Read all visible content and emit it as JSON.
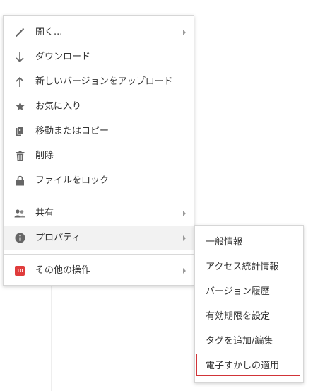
{
  "main_menu": {
    "items": [
      {
        "label": "開く...",
        "icon": "pencil-icon",
        "has_submenu": true
      },
      {
        "label": "ダウンロード",
        "icon": "arrow-down-icon",
        "has_submenu": false
      },
      {
        "label": "新しいバージョンをアップロード",
        "icon": "arrow-up-icon",
        "has_submenu": false
      },
      {
        "label": "お気に入り",
        "icon": "star-icon",
        "has_submenu": false
      },
      {
        "label": "移動またはコピー",
        "icon": "copy-icon",
        "has_submenu": false
      },
      {
        "label": "削除",
        "icon": "trash-icon",
        "has_submenu": false
      },
      {
        "label": "ファイルをロック",
        "icon": "lock-icon",
        "has_submenu": false
      },
      {
        "label": "共有",
        "icon": "users-icon",
        "has_submenu": true
      },
      {
        "label": "プロパティ",
        "icon": "info-icon",
        "has_submenu": true,
        "active": true
      },
      {
        "label": "その他の操作",
        "icon": "apps-badge-icon",
        "badge_text": "10",
        "has_submenu": true
      }
    ]
  },
  "properties_submenu": {
    "items": [
      {
        "label": "一般情報"
      },
      {
        "label": "アクセス統計情報"
      },
      {
        "label": "バージョン履歴"
      },
      {
        "label": "有効期限を設定"
      },
      {
        "label": "タグを追加/編集"
      },
      {
        "label": "電子すかしの適用",
        "highlighted": true
      }
    ]
  },
  "colors": {
    "icon": "#666666",
    "text": "#333333",
    "active_row": "#f2f2f2",
    "highlight_border": "#d13438",
    "badge": "#e03c3c"
  }
}
